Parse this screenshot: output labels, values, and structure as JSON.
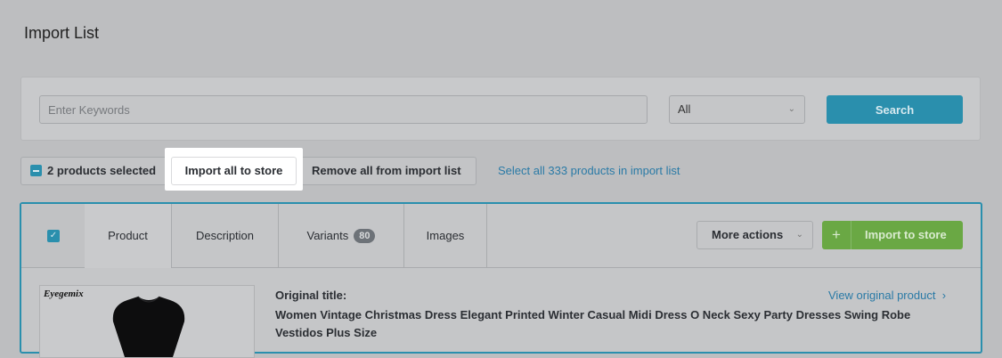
{
  "page": {
    "title": "Import List"
  },
  "search": {
    "placeholder": "Enter Keywords",
    "filter_value": "All",
    "button_label": "Search"
  },
  "bulk": {
    "selected_label": "2 products selected",
    "import_all_label": "Import all to store",
    "remove_all_label": "Remove all from import list",
    "select_all_link": "Select all 333 products in import list"
  },
  "product": {
    "tabs": [
      {
        "label": "Product"
      },
      {
        "label": "Description"
      },
      {
        "label": "Variants",
        "badge": "80"
      },
      {
        "label": "Images"
      }
    ],
    "more_actions_label": "More actions",
    "import_button_label": "Import to store",
    "original_title_label": "Original title:",
    "original_title": "Women Vintage Christmas Dress Elegant Printed Winter Casual Midi Dress O Neck Sexy Party Dresses Swing Robe Vestidos Plus Size",
    "view_original_label": "View original product",
    "thumbnail_brand": "Eyegemix"
  },
  "colors": {
    "accent": "#2a8fad",
    "import_green": "#6aa844",
    "link": "#2a7aa6"
  }
}
